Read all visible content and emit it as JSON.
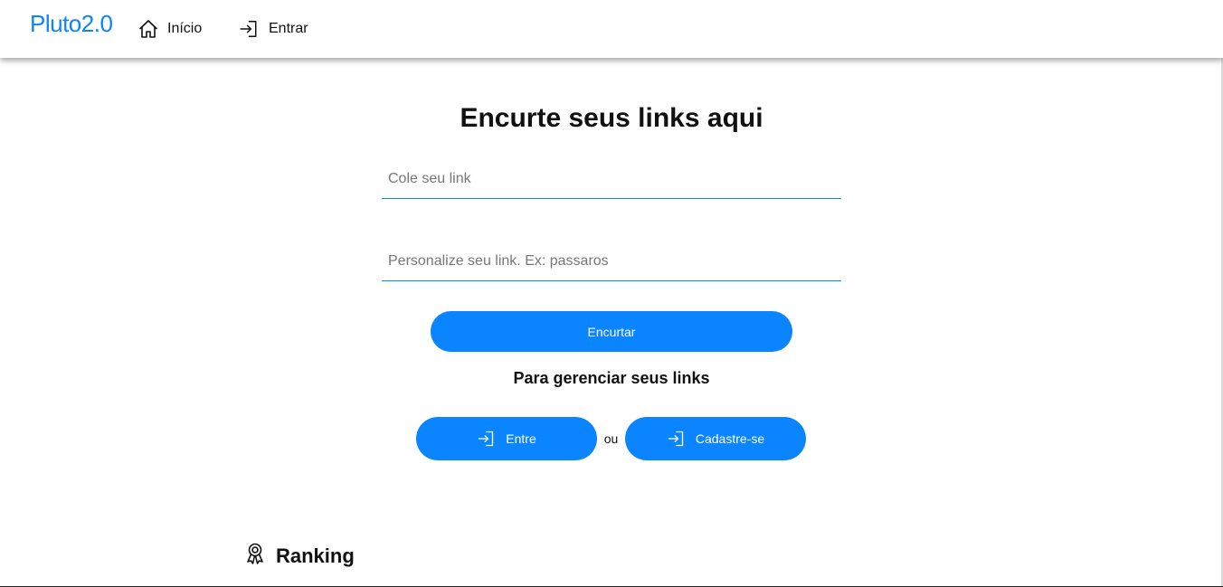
{
  "navbar": {
    "brand": "Pluto2.0",
    "items": [
      {
        "label": "Início",
        "icon": "home-icon"
      },
      {
        "label": "Entrar",
        "icon": "login-icon"
      }
    ]
  },
  "main": {
    "title": "Encurte seus links aqui",
    "link_input": {
      "value": "",
      "placeholder": "Cole seu link"
    },
    "custom_input": {
      "value": "",
      "placeholder": "Personalize seu link. Ex: passaros"
    },
    "shorten_label": "Encurtar",
    "manage_text": "Para gerenciar seus links",
    "enter_label": "Entre",
    "or_text": "ou",
    "signup_label": "Cadastre-se"
  },
  "ranking": {
    "label": "Ranking",
    "icon": "award-icon"
  },
  "colors": {
    "accent": "#0a84ff",
    "text": "#111111",
    "background": "#ffffff"
  }
}
